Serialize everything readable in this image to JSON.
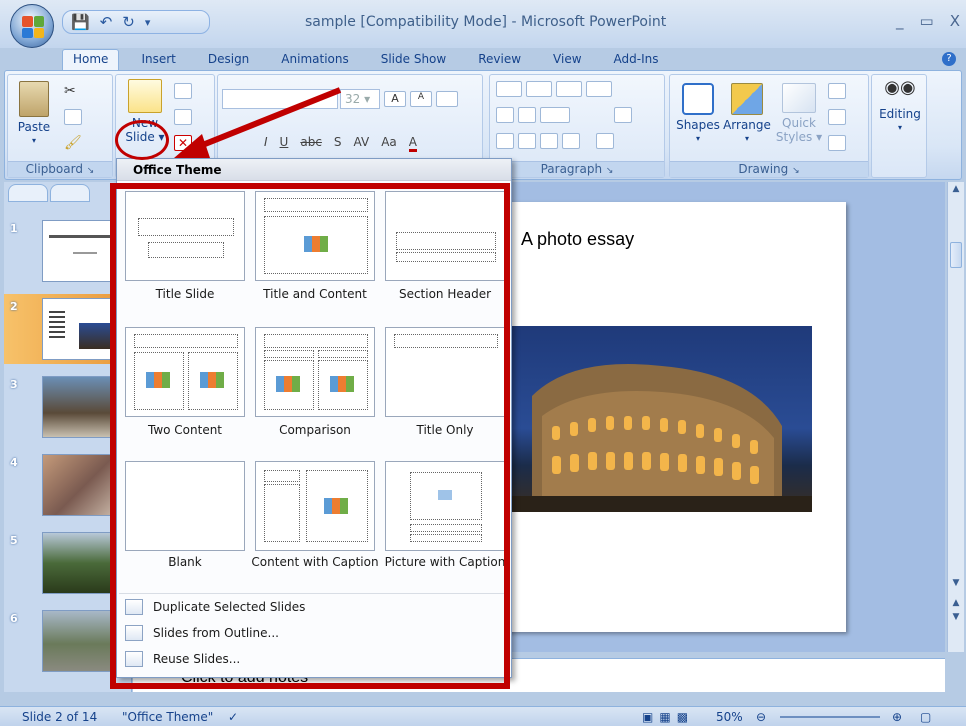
{
  "window": {
    "title": "sample [Compatibility Mode] - Microsoft PowerPoint",
    "min": "_",
    "max": "▭",
    "close": "X"
  },
  "tabs": [
    "Home",
    "Insert",
    "Design",
    "Animations",
    "Slide Show",
    "Review",
    "View",
    "Add-Ins"
  ],
  "ribbon": {
    "paste": "Paste",
    "new_slide": "New",
    "new_slide2": "Slide",
    "font_size": "32",
    "shapes": "Shapes",
    "arrange": "Arrange",
    "quick": "Quick",
    "styles": "Styles",
    "editing": "Editing",
    "groups": {
      "clipboard": "Clipboard",
      "paragraph": "Paragraph",
      "drawing": "Drawing"
    }
  },
  "dropdown": {
    "header": "Office Theme",
    "layouts": [
      {
        "label": "Title Slide"
      },
      {
        "label": "Title and Content"
      },
      {
        "label": "Section Header"
      },
      {
        "label": "Two Content"
      },
      {
        "label": "Comparison"
      },
      {
        "label": "Title Only"
      },
      {
        "label": "Blank"
      },
      {
        "label": "Content with Caption"
      },
      {
        "label": "Picture with Caption"
      }
    ],
    "items": [
      "Duplicate Selected Slides",
      "Slides from Outline...",
      "Reuse Slides..."
    ]
  },
  "slides": {
    "numbers": [
      "1",
      "2",
      "3",
      "4",
      "5",
      "6"
    ],
    "current_subtitle": "A photo essay"
  },
  "notes": {
    "text": "Click to add notes"
  },
  "status": {
    "slide_info": "Slide 2 of 14",
    "theme": "\"Office Theme\"",
    "zoom": "50%"
  }
}
